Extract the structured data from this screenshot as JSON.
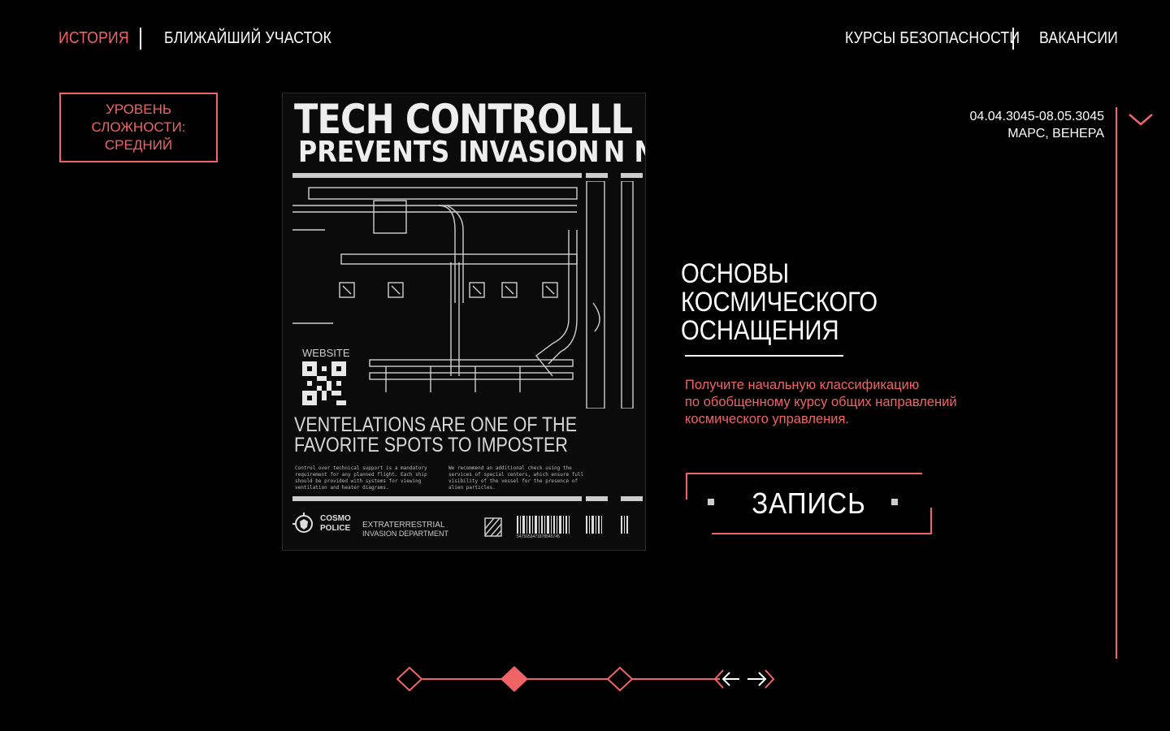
{
  "nav": {
    "history": "ИСТОРИЯ",
    "nearest_station": "БЛИЖАЙШИЙ УЧАСТОК",
    "safety_courses": "КУРСЫ БЕЗОПАСНОСТИ",
    "vacancies": "ВАКАНСИИ"
  },
  "difficulty": {
    "line1": "УРОВЕНЬ",
    "line2": "СЛОЖНОСТИ:",
    "line3": "СРЕДНИЙ"
  },
  "event": {
    "dates": "04.04.3045-08.05.3045",
    "location": "МАРС, ВЕНЕРА"
  },
  "course": {
    "title_line1": "ОСНОВЫ",
    "title_line2": "КОСМИЧЕСКОГО",
    "title_line3": "ОСНАЩЕНИЯ",
    "desc_line1": "Получите начальную классификацию",
    "desc_line2": "по обобщенному курсу общих направлений",
    "desc_line3": "космического управления."
  },
  "enroll_button": "ЗАПИСЬ",
  "poster": {
    "title": "TECH CONTROL",
    "title_echo": "LL",
    "subtitle": "PREVENTS INVASION",
    "subtitle_echo": "N N",
    "website": "WEBSITE",
    "vent_line1": "VENTELATIONS ARE ONE OF THE",
    "vent_line2": "FAVORITE SPOTS TO IMPOSTER",
    "fine_left": "Control over technical support is a mandatory requirement for any planned flight. Each ship should be provided with systems for viewing ventilation and heater diagrams.",
    "fine_right": "We recommend an additional check using the services of special centers, which ensure full visibility of the vessel for the presence of alien particles.",
    "logo_line1": "COSMO",
    "logo_line2": "POLICE",
    "dept_line1": "EXTRATERRESTRIAL",
    "dept_line2": "INVASION DEPARTMENT",
    "barcode_number": "5475653471878545745"
  },
  "pagination": {
    "total": 3,
    "active": 2
  },
  "colors": {
    "accent": "#f06465",
    "background": "#000000",
    "text": "#ffffff"
  }
}
